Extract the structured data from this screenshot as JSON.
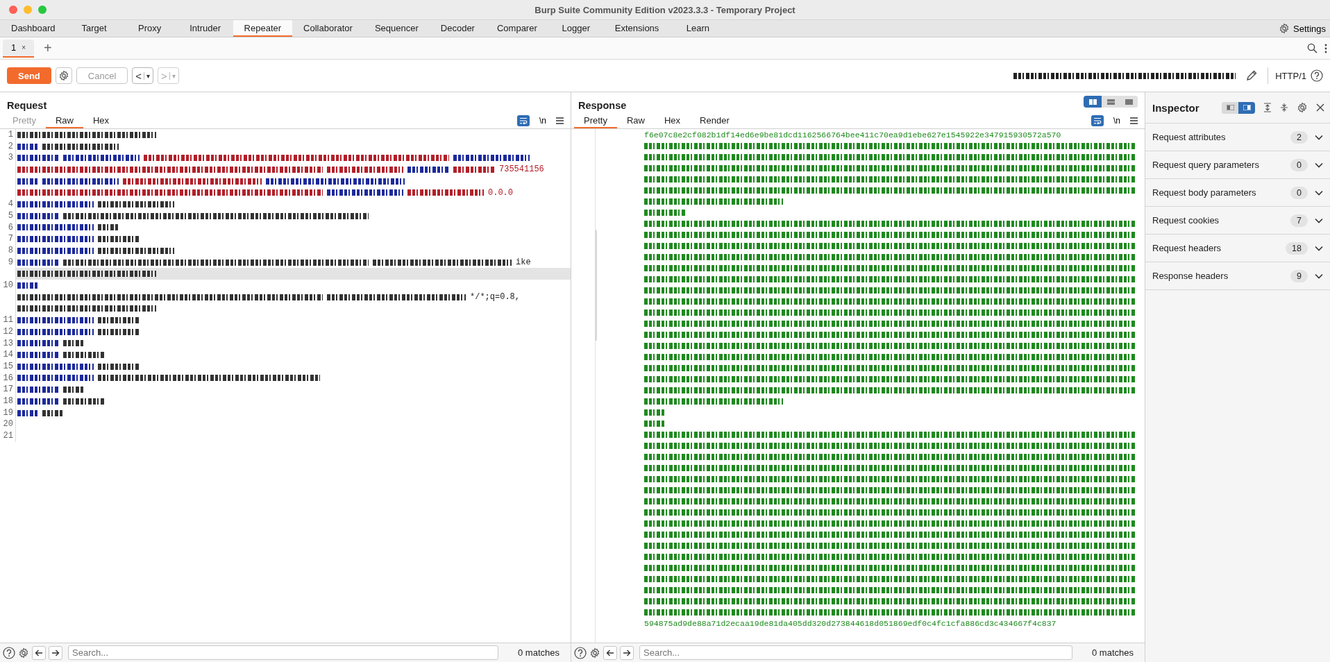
{
  "window": {
    "title": "Burp Suite Community Edition v2023.3.3 - Temporary Project"
  },
  "main_tabs": [
    {
      "label": "Dashboard",
      "selected": false
    },
    {
      "label": "Target",
      "selected": false
    },
    {
      "label": "Proxy",
      "selected": false
    },
    {
      "label": "Intruder",
      "selected": false
    },
    {
      "label": "Repeater",
      "selected": true
    },
    {
      "label": "Collaborator",
      "selected": false
    },
    {
      "label": "Sequencer",
      "selected": false
    },
    {
      "label": "Decoder",
      "selected": false
    },
    {
      "label": "Comparer",
      "selected": false
    },
    {
      "label": "Logger",
      "selected": false
    },
    {
      "label": "Extensions",
      "selected": false
    },
    {
      "label": "Learn",
      "selected": false
    }
  ],
  "settings": {
    "label": "Settings"
  },
  "repeater_tabs": [
    {
      "label": "1",
      "close": "×",
      "selected": true
    }
  ],
  "new_tab": "+",
  "toolbar": {
    "send": "Send",
    "cancel": {
      "label": "Cancel",
      "disabled": true
    },
    "back": {
      "arrow": "<",
      "caret": "▾",
      "disabled": false
    },
    "forward": {
      "arrow": ">",
      "caret": "▾",
      "disabled": true
    },
    "target": {
      "kind": "wide",
      "color": "#222222"
    },
    "protocol": "HTTP/1"
  },
  "request": {
    "title": "Request",
    "tabs": [
      {
        "label": "Pretty",
        "selected": false,
        "disabled": true
      },
      {
        "label": "Raw",
        "selected": true,
        "disabled": false
      },
      {
        "label": "Hex",
        "selected": false,
        "disabled": false
      }
    ],
    "newline": "\\n",
    "lines": [
      {
        "number": "1",
        "current": false,
        "rows": [
          [
            {
              "kind": "long",
              "color": "#333333"
            }
          ]
        ]
      },
      {
        "number": "2",
        "current": false,
        "rows": [
          [
            {
              "kind": "tiny",
              "color": "#1c2a9c"
            },
            {
              "kind": "medium",
              "color": "#333333"
            }
          ]
        ]
      },
      {
        "number": "3",
        "current": false,
        "rows": [
          [
            {
              "kind": "short",
              "color": "#1c2a9c"
            },
            {
              "kind": "medium",
              "color": "#1c2a9c"
            },
            {
              "kind": "huge",
              "color": "#b3202a"
            },
            {
              "kind": "medium",
              "color": "#1c2a9c"
            }
          ],
          [
            {
              "kind": "huge",
              "color": "#b3202a"
            },
            {
              "kind": "medium",
              "color": "#b3202a"
            },
            {
              "kind": "short",
              "color": "#1c2a9c"
            },
            {
              "kind": "short",
              "color": "#b3202a"
            },
            {
              "kind": "text",
              "text": "735541156",
              "color": "#b3202a"
            }
          ],
          [
            {
              "kind": "tiny",
              "color": "#1c2a9c"
            },
            {
              "kind": "medium",
              "color": "#1c2a9c"
            },
            {
              "kind": "long",
              "color": "#b3202a"
            },
            {
              "kind": "long",
              "color": "#1c2a9c"
            }
          ],
          [
            {
              "kind": "huge",
              "color": "#b3202a"
            },
            {
              "kind": "medium",
              "color": "#1c2a9c"
            },
            {
              "kind": "medium",
              "color": "#b3202a"
            },
            {
              "kind": "text",
              "text": "0.0.0",
              "color": "#b3202a"
            }
          ]
        ]
      },
      {
        "number": "4",
        "current": false,
        "rows": [
          [
            {
              "kind": "medium",
              "color": "#1c2a9c"
            },
            {
              "kind": "medium",
              "color": "#333333"
            }
          ]
        ]
      },
      {
        "number": "5",
        "current": false,
        "rows": [
          [
            {
              "kind": "short",
              "color": "#1c2a9c"
            },
            {
              "kind": "huge",
              "color": "#333333"
            }
          ]
        ]
      },
      {
        "number": "6",
        "current": false,
        "rows": [
          [
            {
              "kind": "medium",
              "color": "#1c2a9c"
            },
            {
              "kind": "tiny",
              "color": "#333333"
            }
          ]
        ]
      },
      {
        "number": "7",
        "current": false,
        "rows": [
          [
            {
              "kind": "medium",
              "color": "#1c2a9c"
            },
            {
              "kind": "short",
              "color": "#333333"
            }
          ]
        ]
      },
      {
        "number": "8",
        "current": false,
        "rows": [
          [
            {
              "kind": "medium",
              "color": "#1c2a9c"
            },
            {
              "kind": "medium",
              "color": "#333333"
            }
          ]
        ]
      },
      {
        "number": "9",
        "current": true,
        "rows": [
          [
            {
              "kind": "short",
              "color": "#1c2a9c"
            },
            {
              "kind": "huge",
              "color": "#333333"
            },
            {
              "kind": "long",
              "color": "#333333"
            },
            {
              "kind": "text",
              "text": "ike",
              "color": "#222222"
            }
          ],
          [
            {
              "kind": "long",
              "color": "#333333"
            }
          ]
        ]
      },
      {
        "number": "10",
        "current": false,
        "rows": [
          [
            {
              "kind": "tiny",
              "color": "#1c2a9c"
            }
          ],
          [
            {
              "kind": "huge",
              "color": "#333333"
            },
            {
              "kind": "long",
              "color": "#333333"
            },
            {
              "kind": "text",
              "text": "*/*;q=0.8,",
              "color": "#222222"
            }
          ],
          [
            {
              "kind": "long",
              "color": "#333333"
            }
          ]
        ]
      },
      {
        "number": "11",
        "current": false,
        "rows": [
          [
            {
              "kind": "medium",
              "color": "#1c2a9c"
            },
            {
              "kind": "short",
              "color": "#333333"
            }
          ]
        ]
      },
      {
        "number": "12",
        "current": false,
        "rows": [
          [
            {
              "kind": "medium",
              "color": "#1c2a9c"
            },
            {
              "kind": "short",
              "color": "#333333"
            }
          ]
        ]
      },
      {
        "number": "13",
        "current": false,
        "rows": [
          [
            {
              "kind": "short",
              "color": "#1c2a9c"
            },
            {
              "kind": "tiny",
              "color": "#333333"
            }
          ]
        ]
      },
      {
        "number": "14",
        "current": false,
        "rows": [
          [
            {
              "kind": "short",
              "color": "#1c2a9c"
            },
            {
              "kind": "short",
              "color": "#333333"
            }
          ]
        ]
      },
      {
        "number": "15",
        "current": false,
        "rows": [
          [
            {
              "kind": "medium",
              "color": "#1c2a9c"
            },
            {
              "kind": "short",
              "color": "#333333"
            }
          ]
        ]
      },
      {
        "number": "16",
        "current": false,
        "rows": [
          [
            {
              "kind": "medium",
              "color": "#1c2a9c"
            },
            {
              "kind": "wide",
              "color": "#333333"
            }
          ]
        ]
      },
      {
        "number": "17",
        "current": false,
        "rows": [
          [
            {
              "kind": "short",
              "color": "#1c2a9c"
            },
            {
              "kind": "tiny",
              "color": "#333333"
            }
          ]
        ]
      },
      {
        "number": "18",
        "current": false,
        "rows": [
          [
            {
              "kind": "short",
              "color": "#1c2a9c"
            },
            {
              "kind": "short",
              "color": "#333333"
            }
          ]
        ]
      },
      {
        "number": "19",
        "current": false,
        "rows": [
          [
            {
              "kind": "tiny",
              "color": "#1c2a9c"
            },
            {
              "kind": "tiny",
              "color": "#333333"
            }
          ]
        ]
      },
      {
        "number": "20",
        "current": false,
        "rows": [
          []
        ]
      },
      {
        "number": "21",
        "current": false,
        "rows": [
          []
        ]
      }
    ],
    "search": {
      "placeholder": "Search...",
      "matches": "0 matches"
    }
  },
  "response": {
    "title": "Response",
    "views": [
      {
        "selected": true,
        "kind": "split"
      },
      {
        "selected": false,
        "kind": "stacked"
      },
      {
        "selected": false,
        "kind": "single"
      }
    ],
    "tabs": [
      {
        "label": "Pretty",
        "selected": true
      },
      {
        "label": "Raw",
        "selected": false
      },
      {
        "label": "Hex",
        "selected": false
      },
      {
        "label": "Render",
        "selected": false
      }
    ],
    "newline": "\\n",
    "lines": [
      {
        "kind": "text",
        "text": "f6e07c8e2cf082b1df14ed6e9be81dcd1162566764bee411c70ea9d1ebe627e1545922e347915930572a570"
      },
      {
        "kind": "full"
      },
      {
        "kind": "full"
      },
      {
        "kind": "full"
      },
      {
        "kind": "full"
      },
      {
        "kind": "full"
      },
      {
        "kind": "long"
      },
      {
        "kind": "short"
      },
      {
        "kind": "full"
      },
      {
        "kind": "full"
      },
      {
        "kind": "full"
      },
      {
        "kind": "full"
      },
      {
        "kind": "full"
      },
      {
        "kind": "full"
      },
      {
        "kind": "full"
      },
      {
        "kind": "full"
      },
      {
        "kind": "full"
      },
      {
        "kind": "full"
      },
      {
        "kind": "full"
      },
      {
        "kind": "full"
      },
      {
        "kind": "full"
      },
      {
        "kind": "full"
      },
      {
        "kind": "full"
      },
      {
        "kind": "full"
      },
      {
        "kind": "long"
      },
      {
        "kind": "tiny"
      },
      {
        "kind": "tiny"
      },
      {
        "kind": "full"
      },
      {
        "kind": "full"
      },
      {
        "kind": "full"
      },
      {
        "kind": "full"
      },
      {
        "kind": "full"
      },
      {
        "kind": "full"
      },
      {
        "kind": "full"
      },
      {
        "kind": "full"
      },
      {
        "kind": "full"
      },
      {
        "kind": "full"
      },
      {
        "kind": "full"
      },
      {
        "kind": "full"
      },
      {
        "kind": "full"
      },
      {
        "kind": "full"
      },
      {
        "kind": "full"
      },
      {
        "kind": "full"
      },
      {
        "kind": "full"
      },
      {
        "kind": "text",
        "text": "594875ad9de88a71d2ecaa19de81da405dd320d273844618d051869edf0c4fc1cfa886cd3c434667f4c837"
      }
    ],
    "search": {
      "placeholder": "Search...",
      "matches": "0 matches"
    }
  },
  "inspector": {
    "title": "Inspector",
    "layouts": [
      {
        "selected": false
      },
      {
        "selected": true
      }
    ],
    "sections": [
      {
        "label": "Request attributes",
        "count": "2"
      },
      {
        "label": "Request query parameters",
        "count": "0"
      },
      {
        "label": "Request body parameters",
        "count": "0"
      },
      {
        "label": "Request cookies",
        "count": "7"
      },
      {
        "label": "Request headers",
        "count": "18"
      },
      {
        "label": "Response headers",
        "count": "9"
      }
    ]
  }
}
